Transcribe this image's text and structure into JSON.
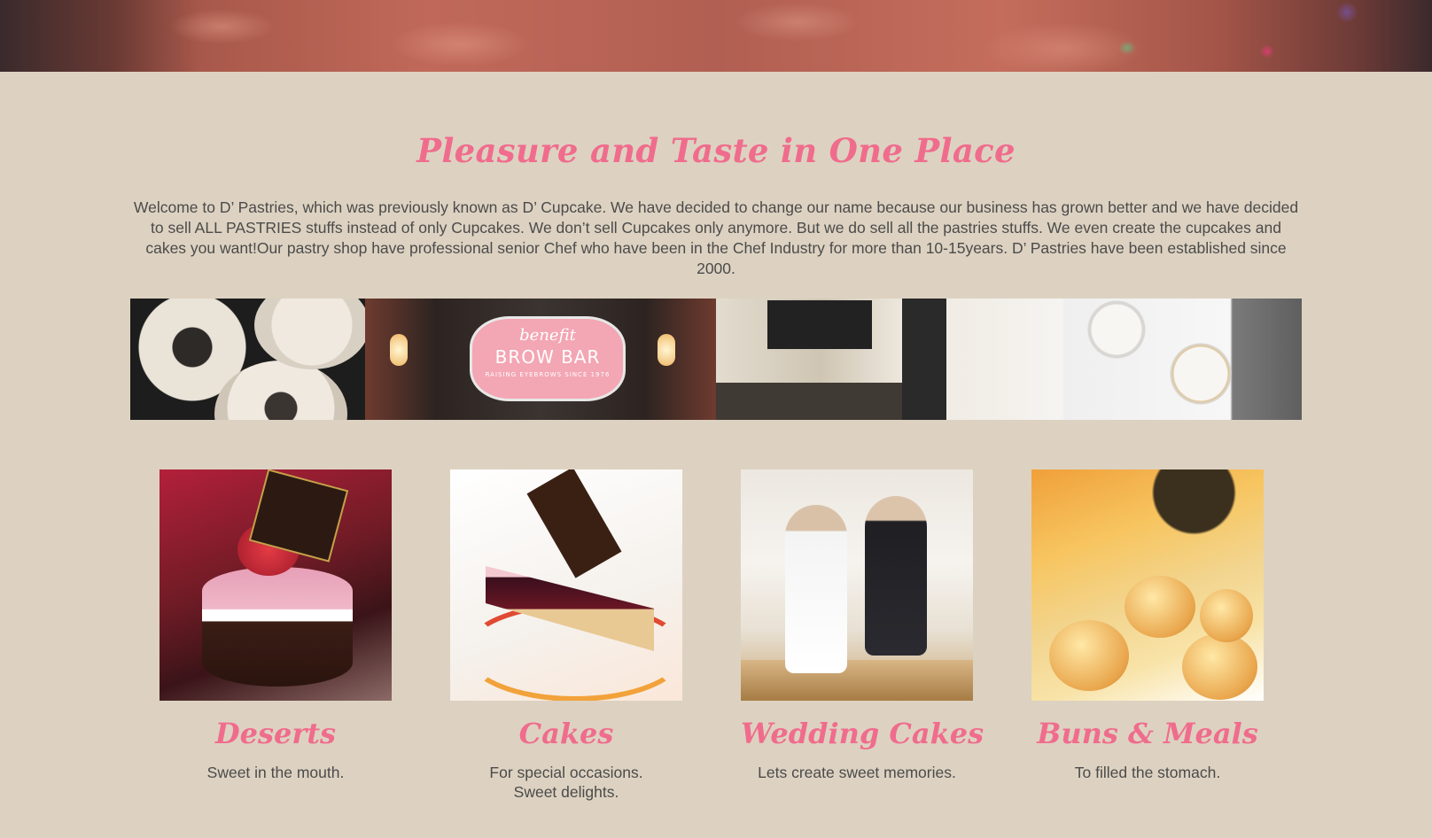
{
  "hero": {
    "image": "pastry close-up banner"
  },
  "intro": {
    "title": "Pleasure and Taste in One Place",
    "text": "Welcome to D’ Pastries, which was previously known as D’ Cupcake. We have decided to change our name because our business has grown better and we have decided to sell ALL PASTRIES stuffs instead of only Cupcakes. We don’t sell Cupcakes only anymore. But we do sell all the pastries stuffs. We even create the cupcakes and cakes you want!Our pastry shop have professional senior Chef who have been in the Chef Industry for more than 10-15years. D’ Pastries have been established since 2000."
  },
  "gallery": {
    "photos": [
      "coffee-cups-photo",
      "brow-bar-sign-photo",
      "pastry-shop-interior-photo",
      "latte-table-photo"
    ],
    "sign": {
      "brand": "benefit",
      "name": "BROW BAR",
      "subtitle": "RAISING EYEBROWS SINCE 1976"
    }
  },
  "categories": [
    {
      "title": "Deserts",
      "description": "Sweet in the mouth."
    },
    {
      "title": "Cakes",
      "description": "For special occasions. Sweet delights."
    },
    {
      "title": "Wedding Cakes",
      "description": "Lets create sweet memories."
    },
    {
      "title": "Buns & Meals",
      "description": "To filled the stomach."
    }
  ],
  "colors": {
    "background": "#ddd2c1",
    "accent_pink": "#f06c8d",
    "body_text": "#4b4b4b"
  }
}
